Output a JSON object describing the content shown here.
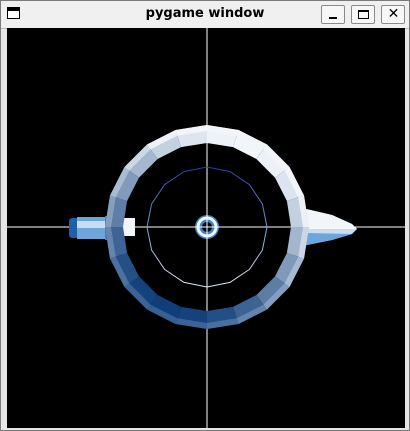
{
  "window": {
    "title": "pygame window",
    "controls": {
      "minimize_glyph": "",
      "maximize_glyph": "",
      "close_glyph": "✕"
    }
  },
  "scene": {
    "background": "#000000",
    "crosshair_color": "#ffffff",
    "palette": {
      "light": "#f2f6fb",
      "mid_light": "#c9ddf1",
      "mid": "#6ea6dc",
      "mid_dark": "#3b82c6",
      "dark": "#1e5fa8",
      "deep": "#0f3e7a",
      "navy_line": "#2244a8"
    }
  }
}
